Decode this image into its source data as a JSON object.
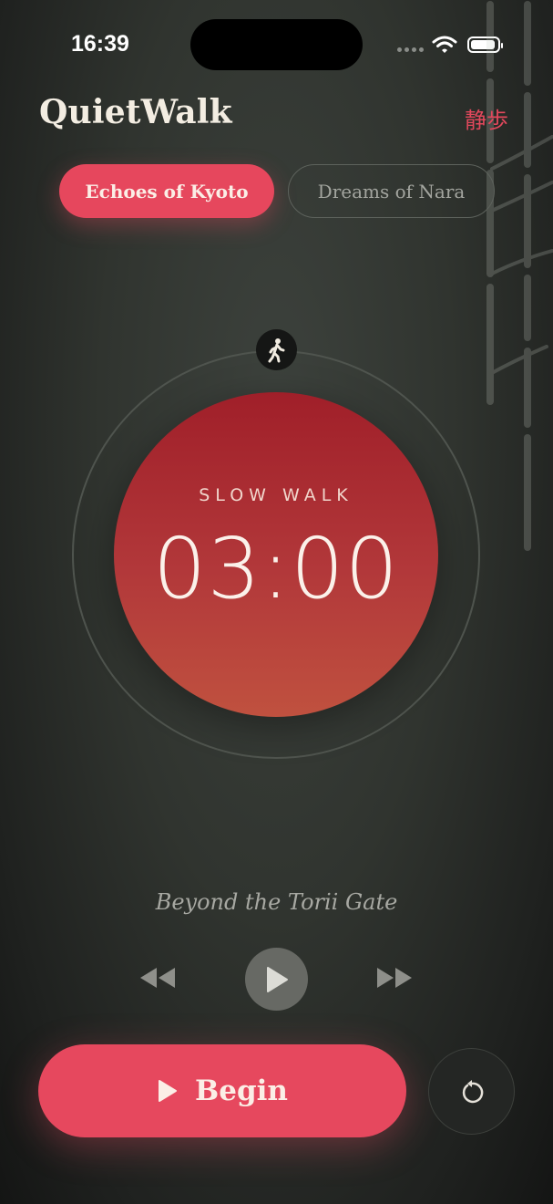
{
  "status_bar": {
    "time": "16:39"
  },
  "header": {
    "app_title": "QuietWalk",
    "subtitle_kanji": "静歩"
  },
  "tabs": [
    {
      "label": "Echoes of Kyoto",
      "selected": true
    },
    {
      "label": "Dreams of Nara",
      "selected": false
    }
  ],
  "timer": {
    "phase_label": "SLOW WALK",
    "time": "03:00"
  },
  "player": {
    "track_title": "Beyond the Torii Gate"
  },
  "actions": {
    "begin_label": "Begin"
  },
  "colors": {
    "accent": "#e6475d",
    "disc_top": "#a01f29",
    "disc_bottom": "#c0513f",
    "background": "#30342f"
  },
  "icons": {
    "walker": "walking-person-icon",
    "rewind": "rewind-icon",
    "play": "play-icon",
    "forward": "fast-forward-icon",
    "begin": "play-icon",
    "reset": "reset-icon"
  }
}
